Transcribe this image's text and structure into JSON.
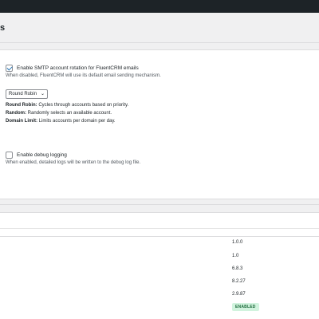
{
  "header": {
    "title": "s"
  },
  "rotation": {
    "checkbox_checked": true,
    "label": "Enable SMTP account rotation for FluentCRM emails",
    "description": "When disabled, FluentCRM will use its default email sending mechanism.",
    "select_value": "Round Robin",
    "options": [
      {
        "name": "Round Robin:",
        "text": " Cycles through accounts based on priority."
      },
      {
        "name": "Random:",
        "text": " Randomly selects an available account."
      },
      {
        "name": "Domain Limit:",
        "text": " Limits accounts per domain per day."
      }
    ]
  },
  "debug": {
    "checkbox_checked": false,
    "label": "Enable debug logging",
    "description": "When enabled, detailed logs will be written to the debug log file."
  },
  "system_info": {
    "values": [
      "1.0.0",
      "1.0",
      "6.8.3",
      "8.2.27",
      "2.9.87"
    ],
    "status_badge": "ENABLED"
  },
  "colors": {
    "admin_bar": "#1d2327",
    "accent": "#2271b1",
    "badge_bg": "#d1f3de",
    "badge_text": "#1e6b3c"
  }
}
